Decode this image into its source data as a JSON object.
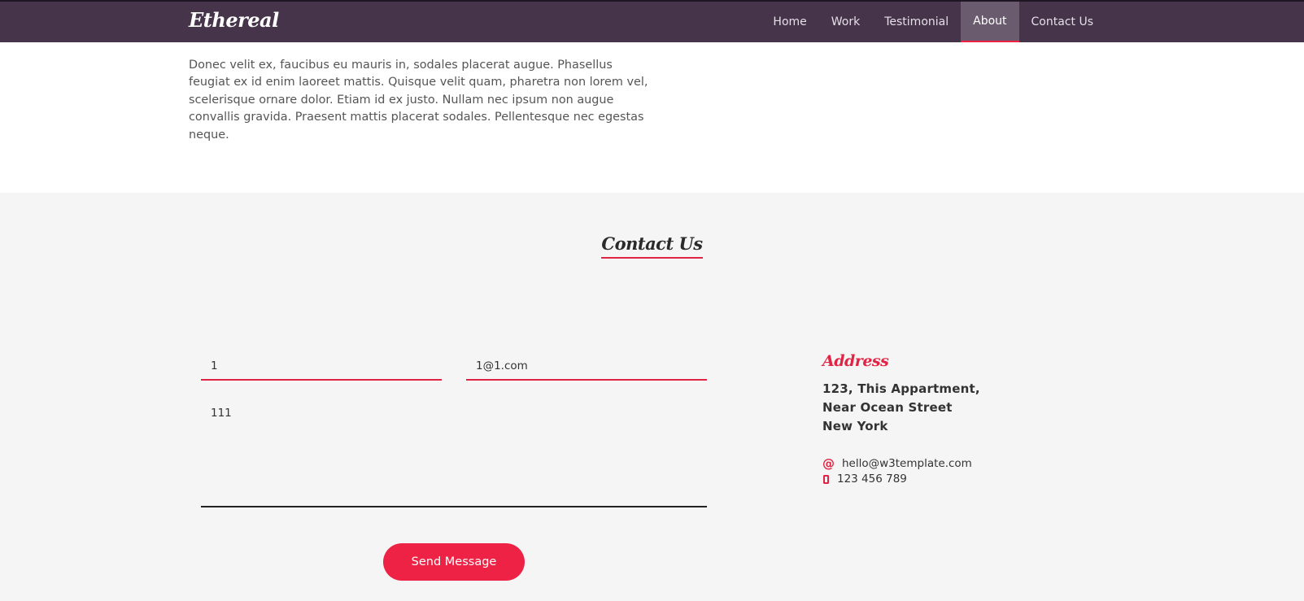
{
  "header": {
    "brand": "Ethereal",
    "nav": [
      {
        "label": "Home",
        "active": false
      },
      {
        "label": "Work",
        "active": false
      },
      {
        "label": "Testimonial",
        "active": false
      },
      {
        "label": "About",
        "active": true
      },
      {
        "label": "Contact Us",
        "active": false
      }
    ]
  },
  "about": {
    "cut_text": "neque.",
    "paragraph": "Donec velit ex, faucibus eu mauris in, sodales placerat augue. Phasellus feugiat ex id enim laoreet mattis. Quisque velit quam, pharetra non lorem vel, scelerisque ornare dolor. Etiam id ex justo. Nullam nec ipsum non augue convallis gravida. Praesent mattis placerat sodales. Pellentesque nec egestas neque."
  },
  "contact": {
    "title": "Contact Us",
    "form": {
      "name_value": "1",
      "email_value": "1@1.com",
      "message_value": "111",
      "send_label": "Send Message"
    },
    "address": {
      "title": "Address",
      "lines": [
        "123, This Appartment,",
        "Near Ocean Street",
        "New York"
      ],
      "email": "hello@w3template.com",
      "phone": "123 456 789"
    }
  },
  "icons": {
    "email": "at-icon",
    "phone": "mobile-phone-icon"
  },
  "colors": {
    "navbar": "#45344a",
    "accent": "#ee2244",
    "section_bg": "#f5f5f5"
  }
}
